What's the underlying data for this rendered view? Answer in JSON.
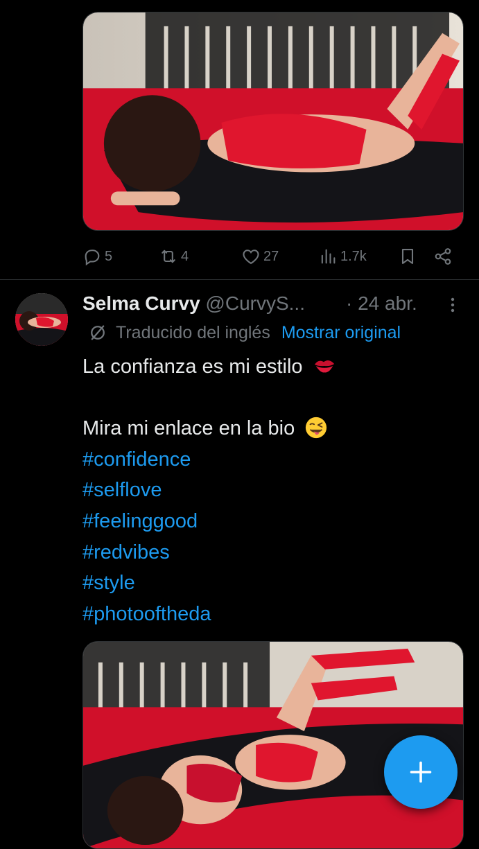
{
  "colors": {
    "background": "#000000",
    "text_primary": "#e7e9ea",
    "text_secondary": "#71767b",
    "accent": "#1d9bf0",
    "divider": "#2f3336"
  },
  "previous_tweet": {
    "media_alt_icon": "photo",
    "actions": {
      "reply_count": "5",
      "retweet_count": "4",
      "like_count": "27",
      "view_count": "1.7k"
    }
  },
  "tweet": {
    "display_name": "Selma Curvy",
    "handle": "@CurvyS...",
    "separator": "·",
    "date": "24 abr.",
    "translation": {
      "label": "Traducido del inglés",
      "show_original": "Mostrar original"
    },
    "text_line_1": "La confianza es mi estilo",
    "text_line_2": "Mira mi enlace en la bio",
    "emoji_1": "kiss-mark-icon",
    "emoji_2": "winking-tongue-face-icon",
    "hashtags": [
      "#confidence",
      "#selflove",
      "#feelinggood",
      "#redvibes",
      "#style",
      "#photooftheda"
    ]
  },
  "fab": {
    "icon": "plus-icon"
  }
}
